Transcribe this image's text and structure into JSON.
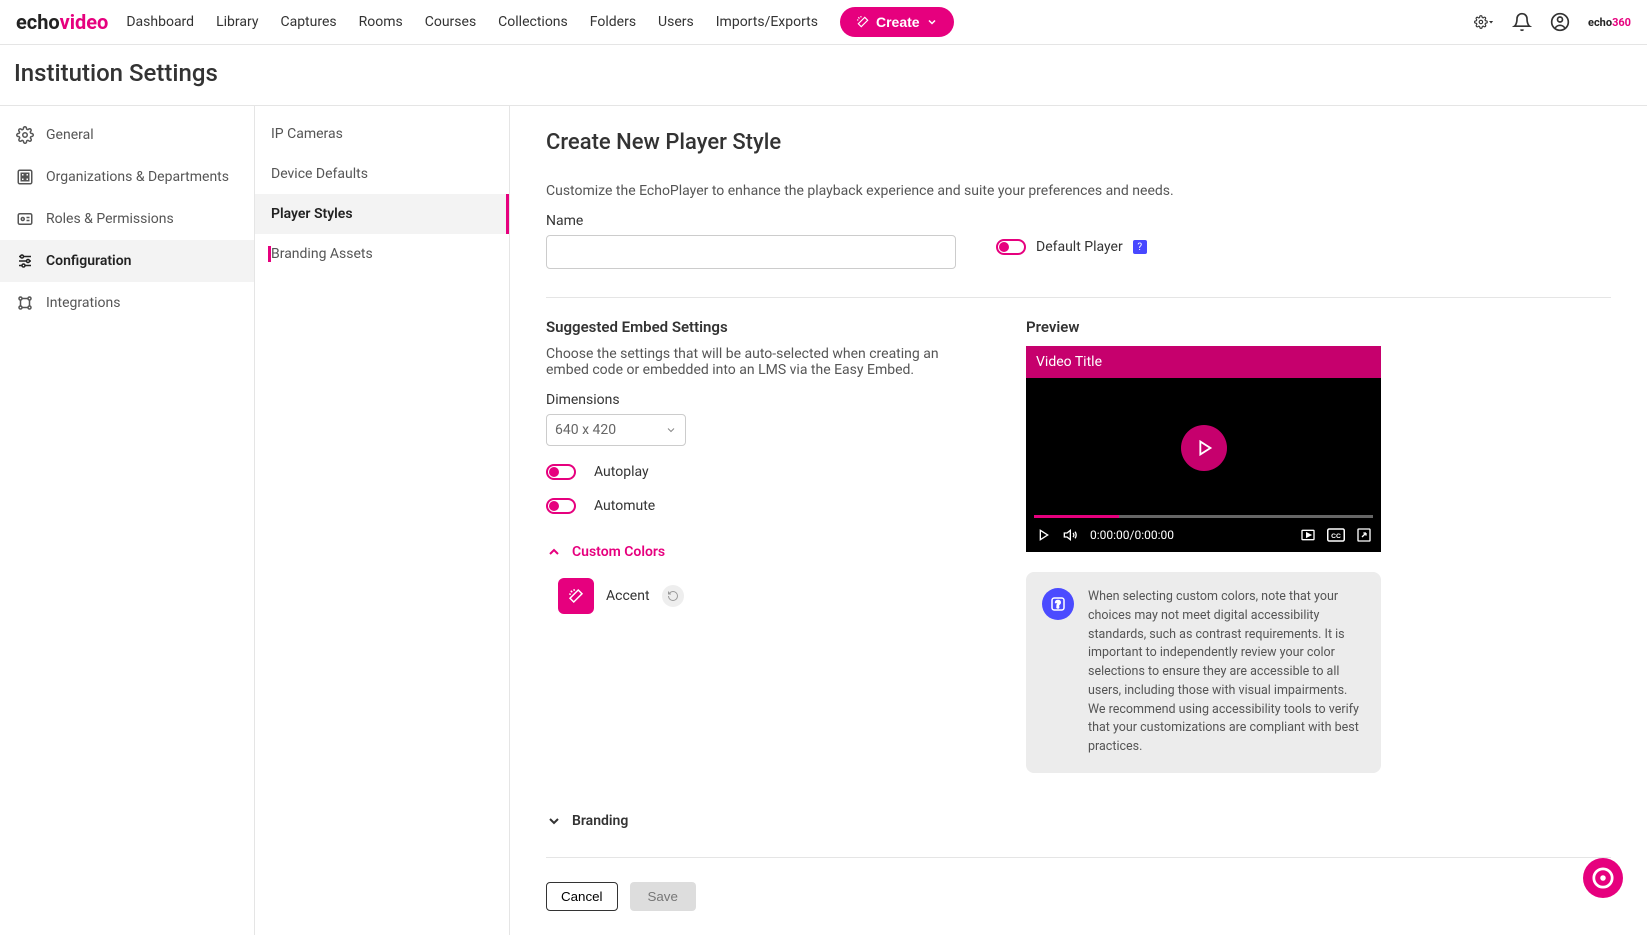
{
  "logo": {
    "part1": "echo",
    "part2": "video"
  },
  "nav": [
    "Dashboard",
    "Library",
    "Captures",
    "Rooms",
    "Courses",
    "Collections",
    "Folders",
    "Users",
    "Imports/Exports"
  ],
  "create_label": "Create",
  "brand360": {
    "p1": "echo",
    "p2": "360"
  },
  "page_title": "Institution Settings",
  "sidebar1": [
    {
      "label": "General",
      "icon": "gear"
    },
    {
      "label": "Organizations & Departments",
      "icon": "org"
    },
    {
      "label": "Roles & Permissions",
      "icon": "badge"
    },
    {
      "label": "Configuration",
      "icon": "sliders",
      "active": true
    },
    {
      "label": "Integrations",
      "icon": "nodes"
    }
  ],
  "sidebar2": [
    {
      "label": "IP Cameras"
    },
    {
      "label": "Device Defaults"
    },
    {
      "label": "Player Styles",
      "active": true
    },
    {
      "label": "Branding Assets"
    }
  ],
  "form": {
    "title": "Create New Player Style",
    "desc": "Customize the EchoPlayer to enhance the playback experience and suite your preferences and needs.",
    "name_label": "Name",
    "name_value": "",
    "default_player_label": "Default Player",
    "embed_heading": "Suggested Embed Settings",
    "embed_desc": "Choose the settings that will be auto-selected when creating an embed code or embedded into an LMS via the Easy Embed.",
    "dimensions_label": "Dimensions",
    "dimensions_value": "640 x 420",
    "autoplay_label": "Autoplay",
    "automute_label": "Automute",
    "custom_colors_label": "Custom Colors",
    "accent_label": "Accent",
    "branding_label": "Branding",
    "cancel_label": "Cancel",
    "save_label": "Save"
  },
  "preview": {
    "heading": "Preview",
    "video_title": "Video Title",
    "time": "0:00:00/0:00:00"
  },
  "info_text": "When selecting custom colors, note that your choices may not meet digital accessibility standards, such as contrast requirements. It is important to independently review your color selections to ensure they are accessible to all users, including those with visual impairments. We recommend using accessibility tools to verify that your customizations are compliant with best practices."
}
